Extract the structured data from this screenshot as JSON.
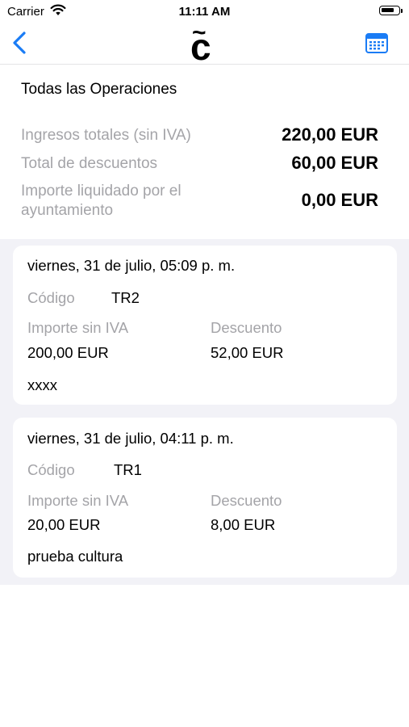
{
  "status_bar": {
    "carrier": "Carrier",
    "time": "11:11 AM"
  },
  "nav": {
    "logo_top": "~",
    "logo_letter": "c",
    "accent_color": "#1a7cf5"
  },
  "summary": {
    "title": "Todas las Operaciones",
    "rows": [
      {
        "label": "Ingresos totales (sin IVA)",
        "value": "220,00 EUR"
      },
      {
        "label": "Total de descuentos",
        "value": "60,00 EUR"
      },
      {
        "label_line1": "Importe liquidado por el",
        "label_line2": "ayuntamiento",
        "value": "0,00 EUR"
      }
    ]
  },
  "operations": [
    {
      "date": "viernes, 31 de julio, 05:09 p. m.",
      "code_label": "Código",
      "code": "TR2",
      "amount_label": "Importe sin IVA",
      "amount": "200,00 EUR",
      "discount_label": "Descuento",
      "discount": "52,00 EUR",
      "note": "xxxx"
    },
    {
      "date": "viernes, 31 de julio, 04:11 p. m.",
      "code_label": "Código",
      "code": "TR1",
      "amount_label": "Importe sin IVA",
      "amount": "20,00 EUR",
      "discount_label": "Descuento",
      "discount": "8,00 EUR",
      "note": "prueba cultura"
    }
  ]
}
